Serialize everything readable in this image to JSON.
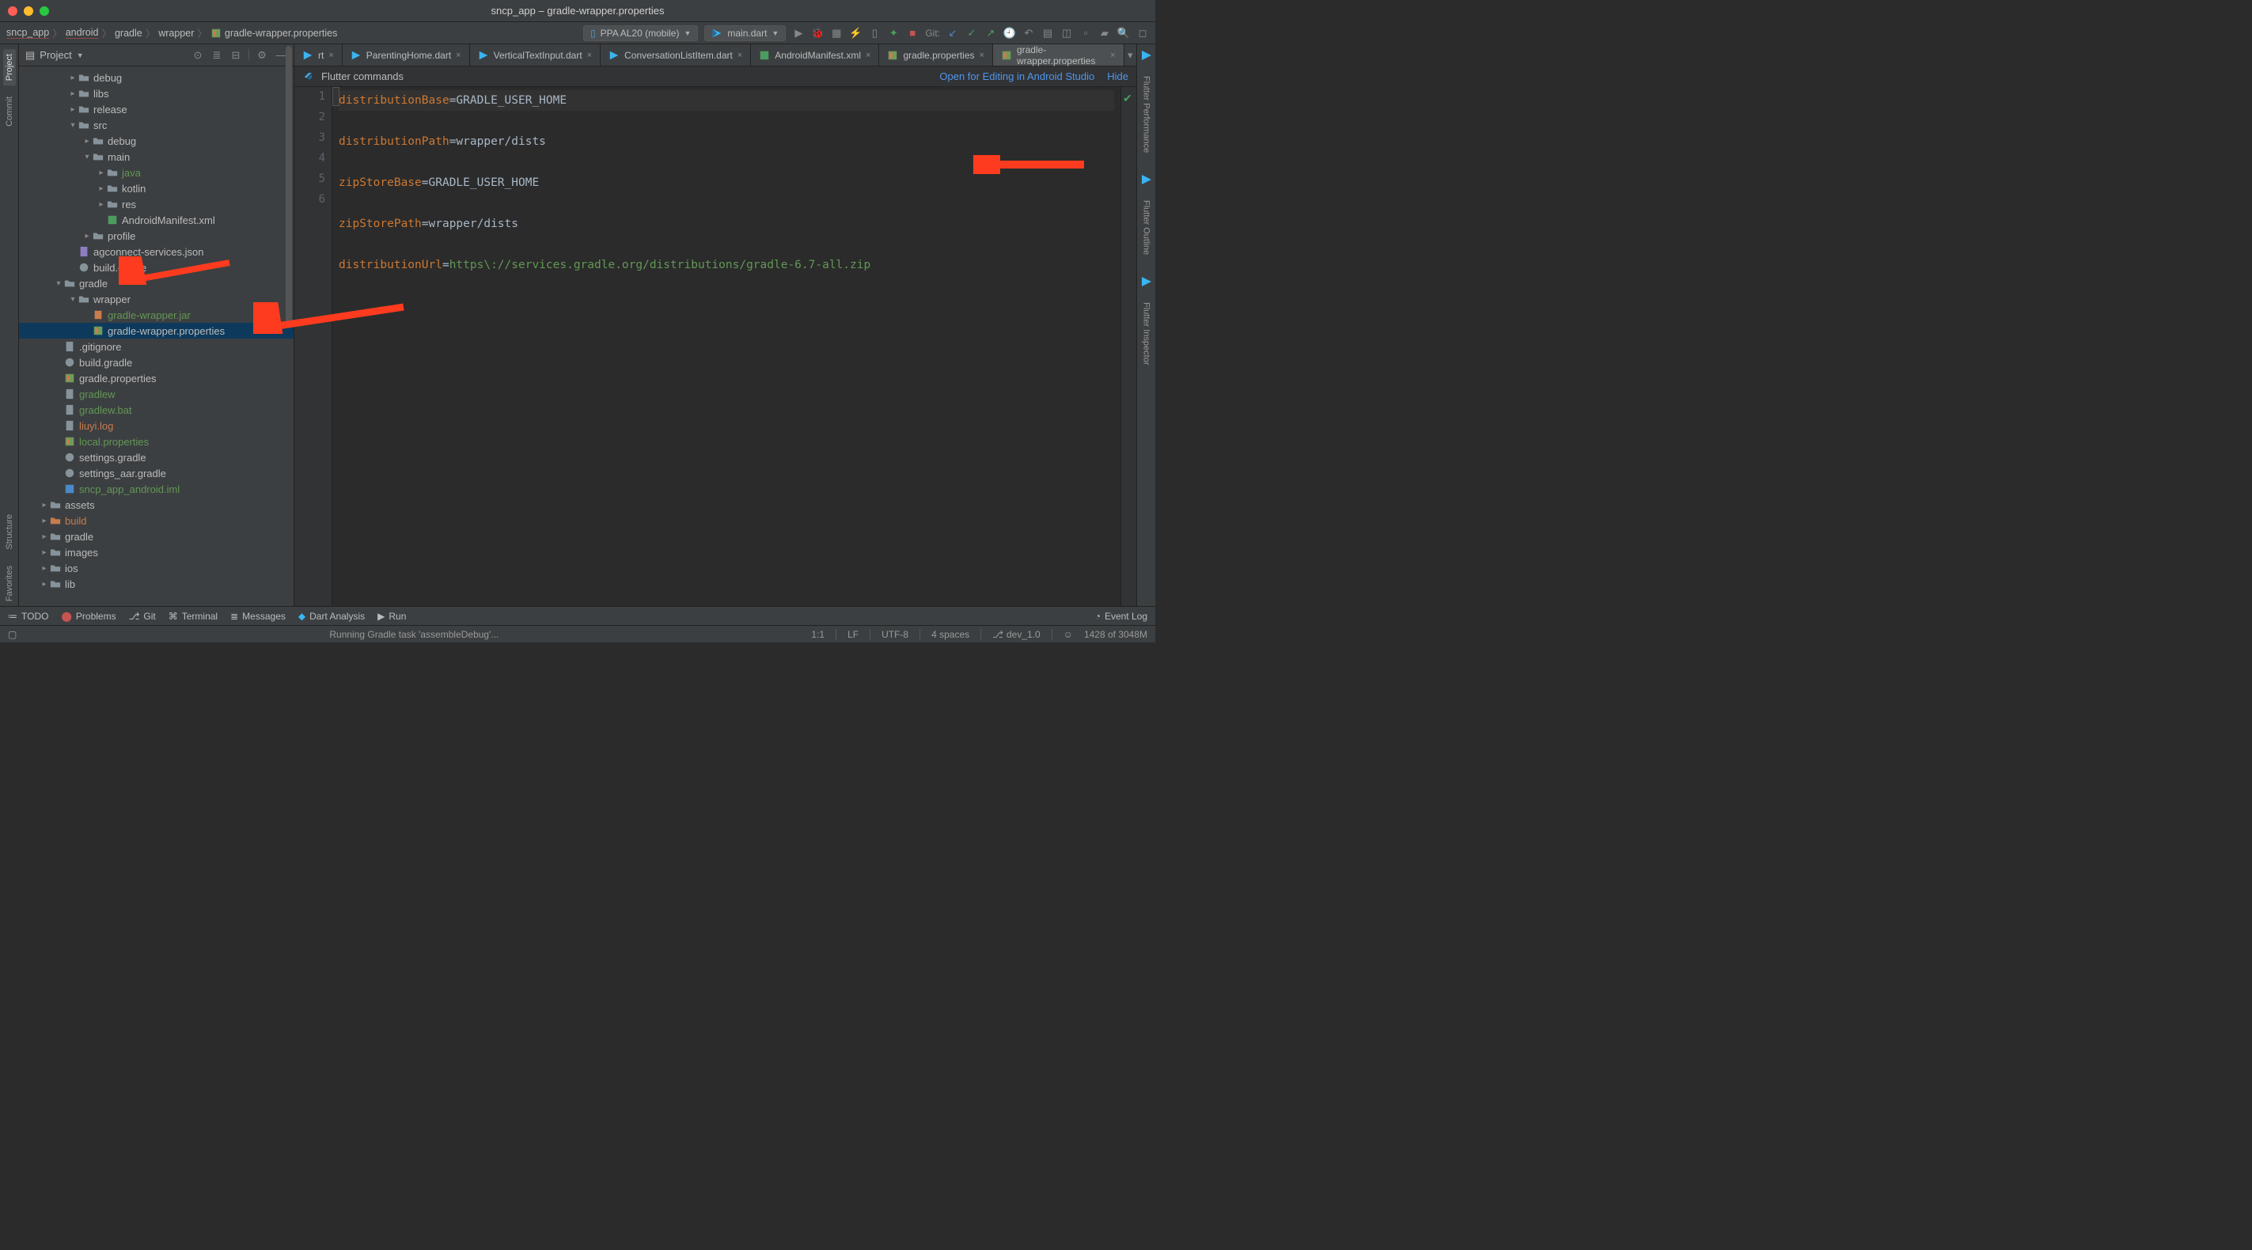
{
  "window": {
    "title": "sncp_app – gradle-wrapper.properties"
  },
  "breadcrumbs": [
    "sncp_app",
    "android",
    "gradle",
    "wrapper",
    "gradle-wrapper.properties"
  ],
  "device_selector": "PPA AL20 (mobile)",
  "run_config": "main.dart",
  "git_label": "Git:",
  "project_panel": {
    "title": "Project"
  },
  "tree": [
    {
      "d": 3,
      "arrow": ">",
      "icon": "folder",
      "label": "debug",
      "cls": ""
    },
    {
      "d": 3,
      "arrow": ">",
      "icon": "folder",
      "label": "libs",
      "cls": ""
    },
    {
      "d": 3,
      "arrow": ">",
      "icon": "folder",
      "label": "release",
      "cls": ""
    },
    {
      "d": 3,
      "arrow": "v",
      "icon": "folder",
      "label": "src",
      "cls": ""
    },
    {
      "d": 4,
      "arrow": ">",
      "icon": "folder",
      "label": "debug",
      "cls": ""
    },
    {
      "d": 4,
      "arrow": "v",
      "icon": "folder",
      "label": "main",
      "cls": ""
    },
    {
      "d": 5,
      "arrow": ">",
      "icon": "folder",
      "label": "java",
      "cls": "vcs-changed"
    },
    {
      "d": 5,
      "arrow": ">",
      "icon": "folder",
      "label": "kotlin",
      "cls": ""
    },
    {
      "d": 5,
      "arrow": ">",
      "icon": "folder",
      "label": "res",
      "cls": ""
    },
    {
      "d": 5,
      "arrow": "",
      "icon": "manifest",
      "label": "AndroidManifest.xml",
      "cls": ""
    },
    {
      "d": 4,
      "arrow": ">",
      "icon": "folder",
      "label": "profile",
      "cls": ""
    },
    {
      "d": 3,
      "arrow": "",
      "icon": "json",
      "label": "agconnect-services.json",
      "cls": ""
    },
    {
      "d": 3,
      "arrow": "",
      "icon": "gradle",
      "label": "build.gradle",
      "cls": ""
    },
    {
      "d": 2,
      "arrow": "v",
      "icon": "folder",
      "label": "gradle",
      "cls": ""
    },
    {
      "d": 3,
      "arrow": "v",
      "icon": "folder",
      "label": "wrapper",
      "cls": ""
    },
    {
      "d": 4,
      "arrow": "",
      "icon": "jar",
      "label": "gradle-wrapper.jar",
      "cls": "vcs-changed"
    },
    {
      "d": 4,
      "arrow": "",
      "icon": "props",
      "label": "gradle-wrapper.properties",
      "cls": "",
      "selected": true
    },
    {
      "d": 2,
      "arrow": "",
      "icon": "file",
      "label": ".gitignore",
      "cls": ""
    },
    {
      "d": 2,
      "arrow": "",
      "icon": "gradle",
      "label": "build.gradle",
      "cls": ""
    },
    {
      "d": 2,
      "arrow": "",
      "icon": "props",
      "label": "gradle.properties",
      "cls": ""
    },
    {
      "d": 2,
      "arrow": "",
      "icon": "file",
      "label": "gradlew",
      "cls": "vcs-changed"
    },
    {
      "d": 2,
      "arrow": "",
      "icon": "file",
      "label": "gradlew.bat",
      "cls": "vcs-changed"
    },
    {
      "d": 2,
      "arrow": "",
      "icon": "file",
      "label": "liuyi.log",
      "cls": "vcs-unknown"
    },
    {
      "d": 2,
      "arrow": "",
      "icon": "props",
      "label": "local.properties",
      "cls": "vcs-changed"
    },
    {
      "d": 2,
      "arrow": "",
      "icon": "gradle",
      "label": "settings.gradle",
      "cls": ""
    },
    {
      "d": 2,
      "arrow": "",
      "icon": "gradle",
      "label": "settings_aar.gradle",
      "cls": ""
    },
    {
      "d": 2,
      "arrow": "",
      "icon": "iml",
      "label": "sncp_app_android.iml",
      "cls": "vcs-changed"
    },
    {
      "d": 1,
      "arrow": ">",
      "icon": "folder",
      "label": "assets",
      "cls": ""
    },
    {
      "d": 1,
      "arrow": ">",
      "icon": "folder-ex",
      "label": "build",
      "cls": "vcs-unknown"
    },
    {
      "d": 1,
      "arrow": ">",
      "icon": "folder",
      "label": "gradle",
      "cls": ""
    },
    {
      "d": 1,
      "arrow": ">",
      "icon": "folder",
      "label": "images",
      "cls": ""
    },
    {
      "d": 1,
      "arrow": ">",
      "icon": "folder",
      "label": "ios",
      "cls": ""
    },
    {
      "d": 1,
      "arrow": ">",
      "icon": "folder",
      "label": "lib",
      "cls": ""
    }
  ],
  "editor_tabs": [
    {
      "icon": "dart",
      "label": "rt",
      "truncated": true
    },
    {
      "icon": "dart",
      "label": "ParentingHome.dart"
    },
    {
      "icon": "dart",
      "label": "VerticalTextInput.dart"
    },
    {
      "icon": "dart",
      "label": "ConversationListItem.dart"
    },
    {
      "icon": "manifest",
      "label": "AndroidManifest.xml"
    },
    {
      "icon": "props",
      "label": "gradle.properties"
    },
    {
      "icon": "props",
      "label": "gradle-wrapper.properties",
      "active": true
    }
  ],
  "flutter_bar": {
    "label": "Flutter commands",
    "link1": "Open for Editing in Android Studio",
    "link2": "Hide"
  },
  "code_lines": [
    {
      "n": 1,
      "key": "distributionBase",
      "eq": "=",
      "val": "GRADLE_USER_HOME"
    },
    {
      "n": 2,
      "key": "distributionPath",
      "eq": "=",
      "val": "wrapper/dists"
    },
    {
      "n": 3,
      "key": "zipStoreBase",
      "eq": "=",
      "val": "GRADLE_USER_HOME"
    },
    {
      "n": 4,
      "key": "zipStorePath",
      "eq": "=",
      "val": "wrapper/dists"
    },
    {
      "n": 5,
      "key": "distributionUrl",
      "eq": "=",
      "url": "https\\://services.gradle.org/distributions/gradle-6.7-all.zip"
    },
    {
      "n": 6
    }
  ],
  "left_rail": [
    {
      "label": "Project",
      "active": true
    },
    {
      "label": "Commit"
    },
    {
      "label": "Structure"
    },
    {
      "label": "Favorites"
    }
  ],
  "right_rail": [
    {
      "label": "Flutter Performance"
    },
    {
      "label": "Flutter Outline"
    },
    {
      "label": "Flutter Inspector"
    }
  ],
  "bottom_tools": {
    "todo": "TODO",
    "problems": "Problems",
    "git": "Git",
    "terminal": "Terminal",
    "messages": "Messages",
    "dart": "Dart Analysis",
    "run": "Run",
    "event_log": "Event Log"
  },
  "status_bar": {
    "running": "Running Gradle task 'assembleDebug'...",
    "pos": "1:1",
    "le": "LF",
    "enc": "UTF-8",
    "indent": "4 spaces",
    "branch": "dev_1.0",
    "mem": "1428 of 3048M"
  }
}
